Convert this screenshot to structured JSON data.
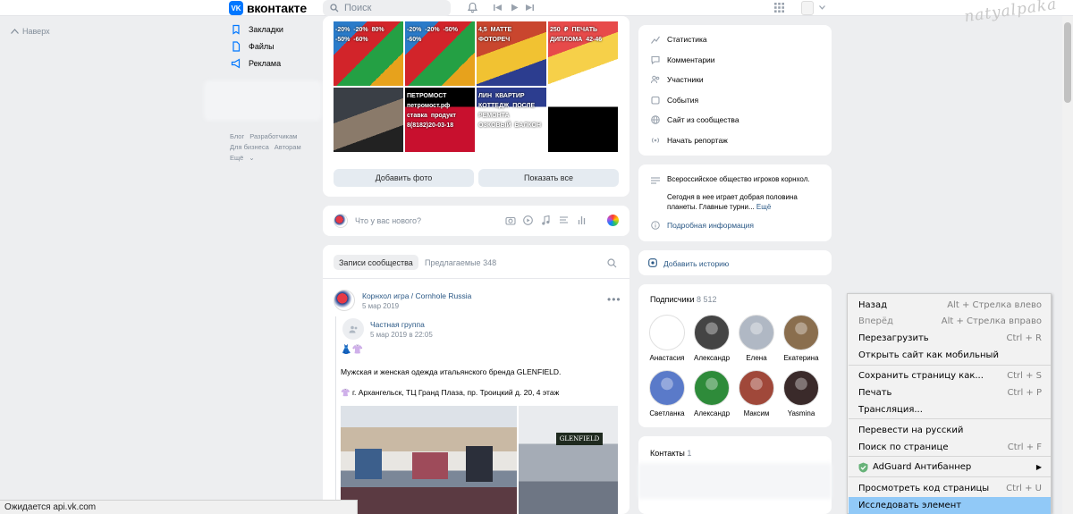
{
  "header": {
    "logo_mark": "VK",
    "logo_text": "вконтакте",
    "search_placeholder": "Поиск",
    "icons": [
      "bell-icon",
      "prev-icon",
      "play-icon",
      "next-icon",
      "apps-grid-icon",
      "avatar",
      "chevron-down-icon"
    ]
  },
  "watermark": "natyalpaka",
  "back_label": "Наверх",
  "nav": [
    {
      "label": "Закладки",
      "icon": "bookmark-icon"
    },
    {
      "label": "Файлы",
      "icon": "file-icon"
    },
    {
      "label": "Реклама",
      "icon": "megaphone-icon"
    }
  ],
  "footer": {
    "row1": [
      "Блог",
      "Разработчикам"
    ],
    "row2": [
      "Для бизнеса",
      "Авторам"
    ],
    "more": "Ещё"
  },
  "photos": {
    "tiles": [
      {
        "label": "-20%  -20%  80%  -50%  -60%",
        "colors": [
          "#2a7bc9",
          "#d2242a",
          "#24a044",
          "#e7a21c"
        ]
      },
      {
        "label": "-20%  -20%  -50%  -60%",
        "colors": [
          "#2a7bc9",
          "#d2242a",
          "#24a044",
          "#e7a21c"
        ]
      },
      {
        "label": "4,5  MATTE  ФОТОРЕЧ",
        "colors": [
          "#c9462e",
          "#f1c232",
          "#2c3d8f"
        ]
      },
      {
        "label": "250 ₽  ПЕЧАТЬ ДИПЛОМА  42-46",
        "colors": [
          "#e74a4a",
          "#f6d049",
          "#ffffff"
        ]
      },
      {
        "label": "",
        "colors": [
          "#3a3f46",
          "#8a7a6a",
          "#222"
        ]
      },
      {
        "label": "ПЕТРОМОСТ  петромост.рф  ставка продукт  8(8182)20-03-18",
        "colors": [
          "#c8102e",
          "#000"
        ]
      },
      {
        "label": "ЛИН  КВАРТИР КОТТЕДЖ  ПОСЛЕ РЕМОНТА  ОЗКОВЫЙ БАЛКОН",
        "colors": [
          "#ffffff",
          "#2c3d8f"
        ]
      },
      {
        "label": "",
        "colors": [
          "#000000",
          "#ffffff"
        ]
      }
    ],
    "add_photo": "Добавить фото",
    "show_all": "Показать все"
  },
  "composer": {
    "placeholder": "Что у вас нового?",
    "icons": [
      "camera-icon",
      "video-icon",
      "music-icon",
      "article-icon",
      "poll-icon",
      "palette-icon"
    ]
  },
  "feed": {
    "tab_active": "Записи сообщества",
    "tab_other": "Предлагаемые",
    "tab_other_count": "348",
    "post": {
      "author": "Корнхол игра / Cornhole Russia",
      "date": "5 мар 2019",
      "repost_author": "Частная группа",
      "repost_date": "5 мар 2019 в 22:05",
      "emojis": "👗👚",
      "text": "Мужская и женская одежда итальянского бренда GLENFIELD.",
      "address": "👚 г. Архангельск, ТЦ Гранд Плаза, пр. Троицкий д. 20, 4 этаж",
      "sign": "GLENFIELD"
    }
  },
  "menu": [
    {
      "label": "Статистика",
      "icon": "chart-icon"
    },
    {
      "label": "Комментарии",
      "icon": "comment-icon"
    },
    {
      "label": "Участники",
      "icon": "users-icon"
    },
    {
      "label": "События",
      "icon": "event-icon"
    },
    {
      "label": "Сайт из сообщества",
      "icon": "globe-icon"
    },
    {
      "label": "Начать репортаж",
      "icon": "broadcast-icon"
    }
  ],
  "description": {
    "line1": "Всероссийское общество игроков корнхол.",
    "line2": "Сегодня в нее играет добрая половина",
    "line3": "планеты. Главные турни...",
    "more": "Ещё",
    "details": "Подробная информация"
  },
  "story": "Добавить историю",
  "subscribers": {
    "title": "Подписчики",
    "count": "8 512",
    "people": [
      {
        "name": "Анастасия",
        "color": "#ffffff"
      },
      {
        "name": "Александр",
        "color": "#444444"
      },
      {
        "name": "Елена",
        "color": "#b0b8c4"
      },
      {
        "name": "Екатерина",
        "color": "#8a6e4e"
      },
      {
        "name": "Светланка",
        "color": "#5a7ac9"
      },
      {
        "name": "Александр",
        "color": "#2e8b3a"
      },
      {
        "name": "Максим",
        "color": "#a0483a"
      },
      {
        "name": "Yasmina",
        "color": "#3a2a2a"
      }
    ]
  },
  "contacts": {
    "title": "Контакты",
    "count": "1"
  },
  "context_menu": [
    {
      "label": "Назад",
      "shortcut": "Alt + Стрелка влево",
      "disabled": false
    },
    {
      "label": "Вперёд",
      "shortcut": "Alt + Стрелка вправо",
      "disabled": true
    },
    {
      "label": "Перезагрузить",
      "shortcut": "Ctrl + R",
      "disabled": false
    },
    {
      "label": "Открыть сайт как мобильный",
      "shortcut": "",
      "disabled": false
    },
    {
      "label": "Сохранить страницу как...",
      "shortcut": "Ctrl + S",
      "disabled": false
    },
    {
      "label": "Печать",
      "shortcut": "Ctrl + P",
      "disabled": false
    },
    {
      "label": "Трансляция...",
      "shortcut": "",
      "disabled": false
    },
    {
      "label": "Перевести на русский",
      "shortcut": "",
      "disabled": false
    },
    {
      "label": "Поиск по странице",
      "shortcut": "Ctrl + F",
      "disabled": false
    },
    {
      "label": "AdGuard Антибаннер",
      "shortcut": "▶",
      "disabled": false
    },
    {
      "label": "Просмотреть код страницы",
      "shortcut": "Ctrl + U",
      "disabled": false
    },
    {
      "label": "Исследовать элемент",
      "shortcut": "",
      "disabled": false
    }
  ],
  "status_bar": "Ожидается api.vk.com"
}
